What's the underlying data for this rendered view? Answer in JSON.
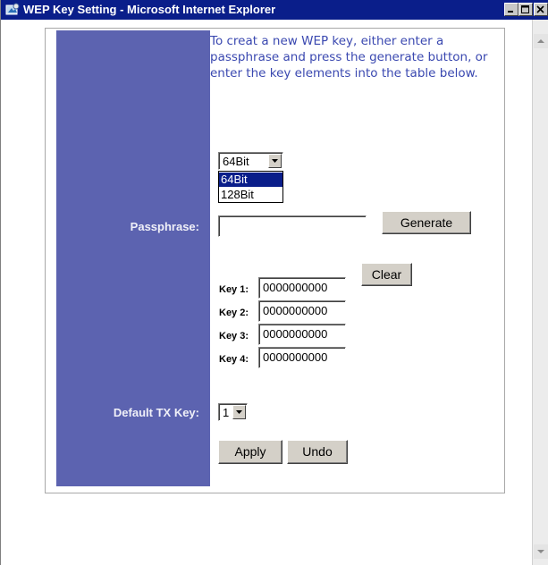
{
  "window": {
    "title": "WEP Key Setting - Microsoft Internet Explorer",
    "icon": "ie-icon",
    "controls": [
      "minimize-icon",
      "maximize-icon",
      "close-icon"
    ]
  },
  "intro_text": "To creat a new WEP key, either enter a passphrase and press the generate button, or enter the key elements into the table below.",
  "key_size": {
    "selected": "64Bit",
    "options": [
      "64Bit",
      "128Bit"
    ]
  },
  "passphrase": {
    "label": "Passphrase:",
    "value": "",
    "generate_label": "Generate"
  },
  "keys": [
    {
      "label": "Key 1:",
      "value": "0000000000"
    },
    {
      "label": "Key 2:",
      "value": "0000000000"
    },
    {
      "label": "Key 3:",
      "value": "0000000000"
    },
    {
      "label": "Key 4:",
      "value": "0000000000"
    }
  ],
  "clear_label": "Clear",
  "default_tx_key": {
    "label": "Default TX Key:",
    "selected": "1"
  },
  "actions": {
    "apply_label": "Apply",
    "undo_label": "Undo"
  },
  "colors": {
    "title_bar": "#0a1e8a",
    "label_column": "#5c63b0",
    "intro_text": "#3a48b0"
  }
}
